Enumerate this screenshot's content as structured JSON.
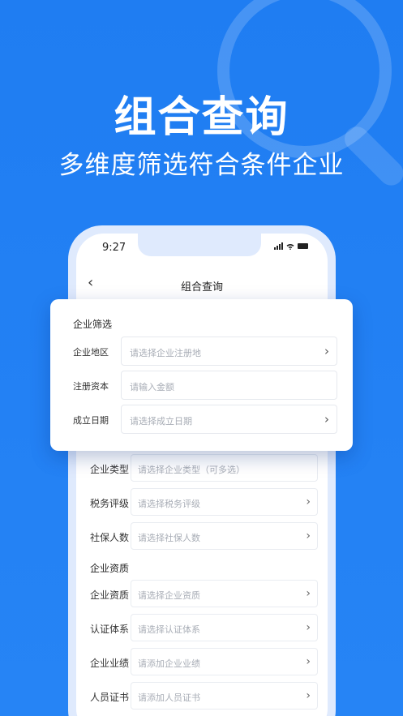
{
  "hero": {
    "title": "组合查询",
    "subtitle": "多维度筛选符合条件企业"
  },
  "status_bar": {
    "time": "9:27",
    "icons": [
      "signal-icon",
      "wifi-icon",
      "battery-icon"
    ]
  },
  "nav": {
    "back_icon": "chevron-left-icon",
    "back_glyph": "‹",
    "title": "组合查询"
  },
  "card": {
    "section_title": "企业筛选",
    "rows": [
      {
        "label": "企业地区",
        "placeholder": "请选择企业注册地",
        "chevron": "›"
      },
      {
        "label": "注册资本",
        "placeholder": "请输入金额",
        "chevron": ""
      },
      {
        "label": "成立日期",
        "placeholder": "请选择成立日期",
        "chevron": "›"
      }
    ]
  },
  "list": {
    "rows_a": [
      {
        "label": "企业类型",
        "placeholder": "请选择企业类型（可多选）",
        "chevron": ""
      },
      {
        "label": "税务评级",
        "placeholder": "请选择税务评级",
        "chevron": "›"
      },
      {
        "label": "社保人数",
        "placeholder": "请选择社保人数",
        "chevron": "›"
      }
    ],
    "section_title": "企业资质",
    "rows_b": [
      {
        "label": "企业资质",
        "placeholder": "请选择企业资质",
        "chevron": "›"
      },
      {
        "label": "认证体系",
        "placeholder": "请选择认证体系",
        "chevron": "›"
      },
      {
        "label": "企业业绩",
        "placeholder": "请添加企业业绩",
        "chevron": "›"
      },
      {
        "label": "人员证书",
        "placeholder": "请添加人员证书",
        "chevron": "›"
      }
    ]
  },
  "colors": {
    "background": "#1f7df2",
    "phone_frame": "#dfeafd",
    "placeholder": "#a8adb6"
  }
}
